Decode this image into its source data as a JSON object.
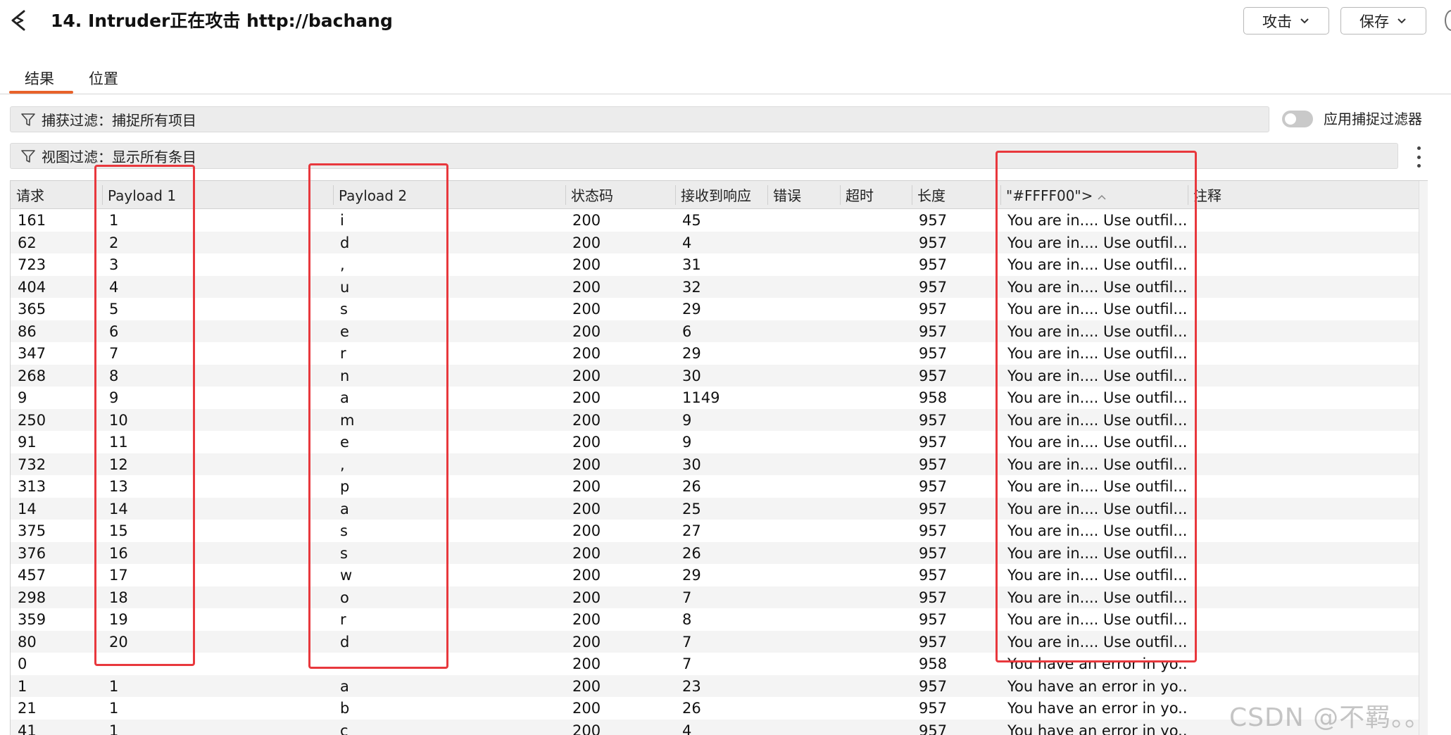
{
  "window": {
    "title": "14. Intruder正在攻击 http://bachang",
    "attack_label": "攻击",
    "save_label": "保存"
  },
  "tabs": [
    {
      "label": "结果",
      "active": true
    },
    {
      "label": "位置",
      "active": false
    }
  ],
  "filters": {
    "capture": "捕获过滤：捕捉所有项目",
    "view": "视图过滤：显示所有条目",
    "apply_capture_label": "应用捕捉过滤器",
    "apply_capture_on": false
  },
  "table": {
    "columns": [
      "请求",
      "Payload 1",
      "Payload 2",
      "状态码",
      "接收到响应",
      "错误",
      "超时",
      "长度",
      "\"#FFFF00\">",
      "注释"
    ],
    "sorted_column": "\"#FFFF00\">",
    "rows": [
      [
        "161",
        "1",
        "i",
        "200",
        "45",
        "",
        "",
        "957",
        "You are in.... Use outfil...",
        ""
      ],
      [
        "62",
        "2",
        "d",
        "200",
        "4",
        "",
        "",
        "957",
        "You are in.... Use outfil...",
        ""
      ],
      [
        "723",
        "3",
        ",",
        "200",
        "31",
        "",
        "",
        "957",
        "You are in.... Use outfil...",
        ""
      ],
      [
        "404",
        "4",
        "u",
        "200",
        "32",
        "",
        "",
        "957",
        "You are in.... Use outfil...",
        ""
      ],
      [
        "365",
        "5",
        "s",
        "200",
        "29",
        "",
        "",
        "957",
        "You are in.... Use outfil...",
        ""
      ],
      [
        "86",
        "6",
        "e",
        "200",
        "6",
        "",
        "",
        "957",
        "You are in.... Use outfil...",
        ""
      ],
      [
        "347",
        "7",
        "r",
        "200",
        "29",
        "",
        "",
        "957",
        "You are in.... Use outfil...",
        ""
      ],
      [
        "268",
        "8",
        "n",
        "200",
        "30",
        "",
        "",
        "957",
        "You are in.... Use outfil...",
        ""
      ],
      [
        "9",
        "9",
        "a",
        "200",
        "1149",
        "",
        "",
        "958",
        "You are in.... Use outfil...",
        ""
      ],
      [
        "250",
        "10",
        "m",
        "200",
        "9",
        "",
        "",
        "957",
        "You are in.... Use outfil...",
        ""
      ],
      [
        "91",
        "11",
        "e",
        "200",
        "9",
        "",
        "",
        "957",
        "You are in.... Use outfil...",
        ""
      ],
      [
        "732",
        "12",
        ",",
        "200",
        "30",
        "",
        "",
        "957",
        "You are in.... Use outfil...",
        ""
      ],
      [
        "313",
        "13",
        "p",
        "200",
        "26",
        "",
        "",
        "957",
        "You are in.... Use outfil...",
        ""
      ],
      [
        "14",
        "14",
        "a",
        "200",
        "25",
        "",
        "",
        "957",
        "You are in.... Use outfil...",
        ""
      ],
      [
        "375",
        "15",
        "s",
        "200",
        "27",
        "",
        "",
        "957",
        "You are in.... Use outfil...",
        ""
      ],
      [
        "376",
        "16",
        "s",
        "200",
        "26",
        "",
        "",
        "957",
        "You are in.... Use outfil...",
        ""
      ],
      [
        "457",
        "17",
        "w",
        "200",
        "29",
        "",
        "",
        "957",
        "You are in.... Use outfil...",
        ""
      ],
      [
        "298",
        "18",
        "o",
        "200",
        "7",
        "",
        "",
        "957",
        "You are in.... Use outfil...",
        ""
      ],
      [
        "359",
        "19",
        "r",
        "200",
        "8",
        "",
        "",
        "957",
        "You are in.... Use outfil...",
        ""
      ],
      [
        "80",
        "20",
        "d",
        "200",
        "7",
        "",
        "",
        "957",
        "You are in.... Use outfil...",
        ""
      ],
      [
        "0",
        "",
        "",
        "200",
        "7",
        "",
        "",
        "958",
        "You have an error in yo...",
        ""
      ],
      [
        "1",
        "1",
        "a",
        "200",
        "23",
        "",
        "",
        "957",
        "You have an error in yo...",
        ""
      ],
      [
        "21",
        "1",
        "b",
        "200",
        "26",
        "",
        "",
        "957",
        "You have an error in yo...",
        ""
      ],
      [
        "41",
        "1",
        "c",
        "200",
        "4",
        "",
        "",
        "957",
        "You have an error in yo...",
        ""
      ]
    ]
  },
  "watermark": "CSDN @不羁。。",
  "colors": {
    "accent": "#e8622a",
    "highlight_box": "#e8383d",
    "header_bg": "#ececec"
  }
}
